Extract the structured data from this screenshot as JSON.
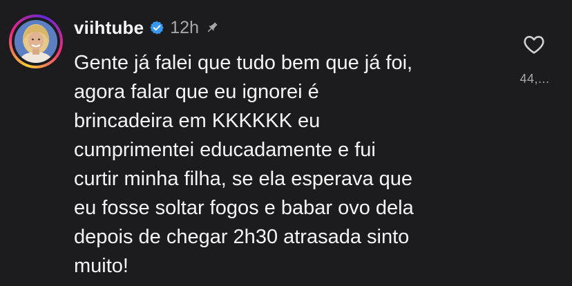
{
  "comment": {
    "username": "viihtube",
    "verified_icon": "verified-badge-icon",
    "time": "12h",
    "pin_icon": "pin-icon",
    "text_lines": [
      "Gente já falei que tudo bem que já foi,",
      "agora falar que eu ignorei é",
      "brincadeira em KKKKKK eu",
      "cumprimentei educadamente e fui",
      "curtir minha filha, se ela esperava que",
      "eu fosse soltar fogos e babar ovo dela",
      "depois de chegar 2h30 atrasada sinto",
      "muito!"
    ],
    "like_icon": "heart-icon",
    "like_count": "44,..."
  },
  "colors": {
    "background": "#1c1c1e",
    "text": "#f5f5f5",
    "muted": "#a8a8a8",
    "verified": "#3897f0"
  }
}
